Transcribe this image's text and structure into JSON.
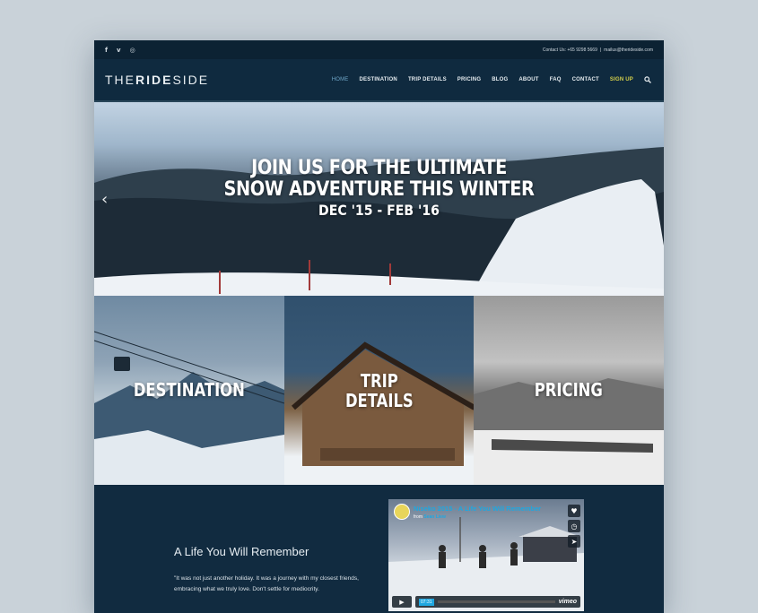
{
  "topbar": {
    "social_icons": [
      "facebook-icon",
      "vimeo-icon",
      "instagram-icon"
    ],
    "facebook": "f",
    "vimeo": "v",
    "instagram": "◎",
    "contact_label": "Contact Us: +65 9298 5669",
    "separator": "|",
    "email": "mailus@therideside.com"
  },
  "nav": {
    "logo_prefix": "THE",
    "logo_bold": "RIDE",
    "logo_suffix": "SIDE",
    "items": [
      "HOME",
      "DESTINATION",
      "TRIP DETAILS",
      "PRICING",
      "BLOG",
      "ABOUT",
      "FAQ",
      "CONTACT",
      "SIGN UP"
    ],
    "active": "HOME",
    "highlight_color": "#d6d04a"
  },
  "hero": {
    "line1": "JOIN US FOR THE ULTIMATE",
    "line2": "SNOW ADVENTURE THIS WINTER",
    "line3": "DEC '15 - FEB '16",
    "prev_arrow": "‹"
  },
  "tiles": [
    {
      "label_line1": "DESTINATION",
      "label_line2": ""
    },
    {
      "label_line1": "TRIP",
      "label_line2": "DETAILS"
    },
    {
      "label_line1": "PRICING",
      "label_line2": ""
    }
  ],
  "lower": {
    "title": "A Life You Will Remember",
    "quote": "\"It was not just another holiday. It was a journey with my closest friends, embracing what we truly love. Don't settle for mediocrity."
  },
  "video": {
    "title": "Niseko 2015 - A Life You Will Remember",
    "from_label": "from",
    "author": "Sean Liew",
    "time": "07:31",
    "brand": "vimeo",
    "like": "♥",
    "later": "◷",
    "share": "➤",
    "play": "▶"
  },
  "colors": {
    "accent": "#1fa7e0",
    "nav_bg": "#0f2a3f",
    "active_link": "#6fa6c8"
  }
}
